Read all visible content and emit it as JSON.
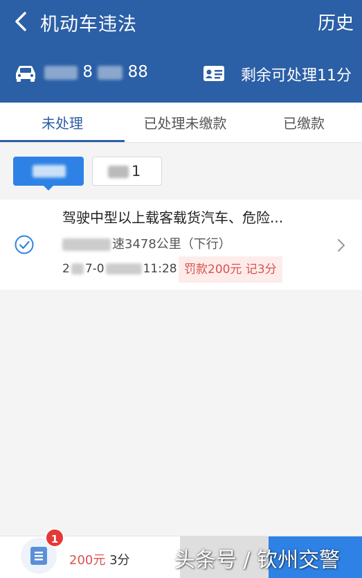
{
  "header": {
    "title": "机动车违法",
    "history_label": "历史",
    "plate_visible_1": "8",
    "plate_visible_2": "88",
    "remaining_label": "剩余可处理11分"
  },
  "tabs": [
    {
      "label": "未处理",
      "active": true
    },
    {
      "label": "已处理未缴款",
      "active": false
    },
    {
      "label": "已缴款",
      "active": false
    }
  ],
  "filters": {
    "chip2_visible": "1"
  },
  "violation": {
    "description": "驾驶中型以上载客载货汽车、危险...",
    "location_visible": "速3478公里（下行）",
    "time_prefix": "2",
    "time_mid": "7-0",
    "time_suffix": "11:28",
    "penalty": "罚款200元 记3分"
  },
  "bottom_bar": {
    "badge_count": "1",
    "amount": "200元",
    "points": "3分"
  },
  "watermark": "头条号 / 钦州交警",
  "colors": {
    "header_bg": "#2b5fa6",
    "accent": "#2e82e5",
    "penalty_text": "#d9534f",
    "badge": "#e53935"
  },
  "icons": [
    "back-arrow-icon",
    "car-icon",
    "license-card-icon",
    "check-circle-icon",
    "chevron-right-icon",
    "document-icon"
  ]
}
